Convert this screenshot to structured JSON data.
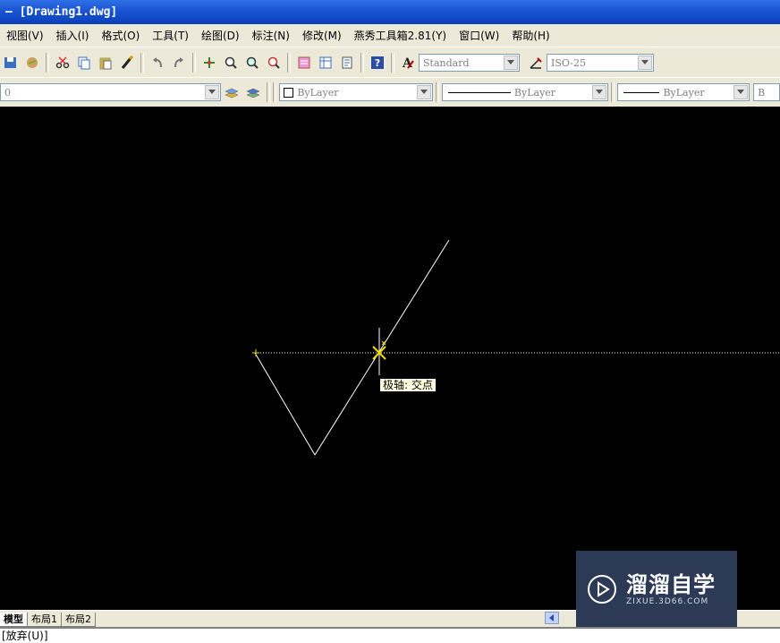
{
  "window": {
    "title": "– [Drawing1.dwg]"
  },
  "menu": [
    "视图(V)",
    "插入(I)",
    "格式(O)",
    "工具(T)",
    "绘图(D)",
    "标注(N)",
    "修改(M)",
    "燕秀工具箱2.81(Y)",
    "窗口(W)",
    "帮助(H)"
  ],
  "toolbar1": {
    "text_style": "Standard",
    "dim_style": "ISO-25"
  },
  "toolbar2": {
    "layer": "0",
    "color": "ByLayer",
    "linetype": "ByLayer",
    "lineweight": "ByLayer",
    "plotstyle": "B"
  },
  "canvas": {
    "tooltip": "极轴: 交点"
  },
  "layout_tabs": [
    "模型",
    "布局1",
    "布局2"
  ],
  "command_line": "[放弃(U)]",
  "watermark": {
    "title": "溜溜自学",
    "subtitle": "ZIXUE.3D66.COM"
  },
  "colors": {
    "canvas_bg": "#000000",
    "snap_marker": "#f0e000",
    "tracking_line": "#ffffff"
  }
}
